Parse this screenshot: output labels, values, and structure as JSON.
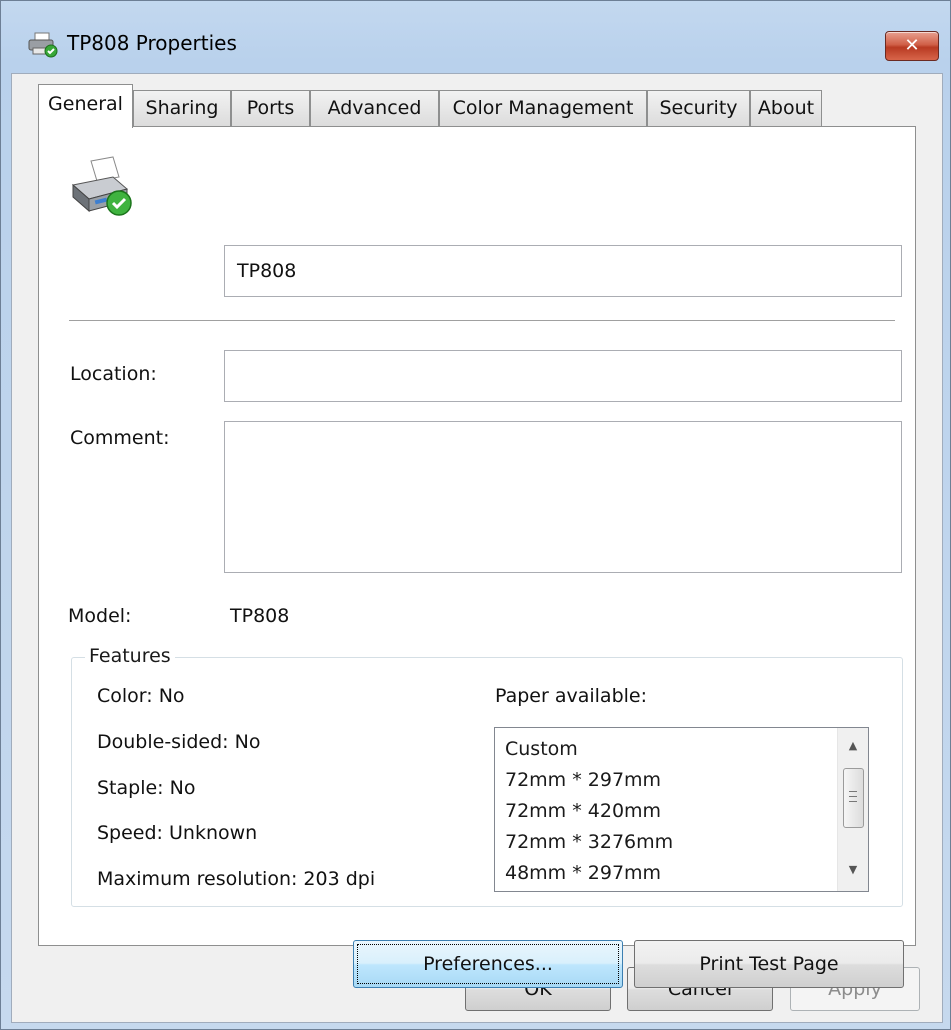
{
  "window": {
    "title": "TP808 Properties",
    "close_label": "✕"
  },
  "tabs": [
    {
      "label": "General",
      "active": true
    },
    {
      "label": "Sharing"
    },
    {
      "label": "Ports"
    },
    {
      "label": "Advanced"
    },
    {
      "label": "Color Management"
    },
    {
      "label": "Security"
    },
    {
      "label": "About"
    }
  ],
  "general": {
    "printer_name": "TP808",
    "location_label": "Location:",
    "location_value": "",
    "comment_label": "Comment:",
    "comment_value": "",
    "model_label": "Model:",
    "model_value": "TP808"
  },
  "features": {
    "legend": "Features",
    "color": "Color: No",
    "double_sided": "Double-sided: No",
    "staple": "Staple: No",
    "speed": "Speed: Unknown",
    "max_resolution": "Maximum resolution: 203 dpi",
    "paper_label": "Paper available:",
    "paper_options": [
      "Custom",
      "72mm * 297mm",
      "72mm * 420mm",
      "72mm * 3276mm",
      "48mm * 297mm"
    ]
  },
  "buttons": {
    "preferences": "Preferences...",
    "print_test_page": "Print Test Page",
    "ok": "OK",
    "cancel": "Cancel",
    "apply": "Apply"
  }
}
